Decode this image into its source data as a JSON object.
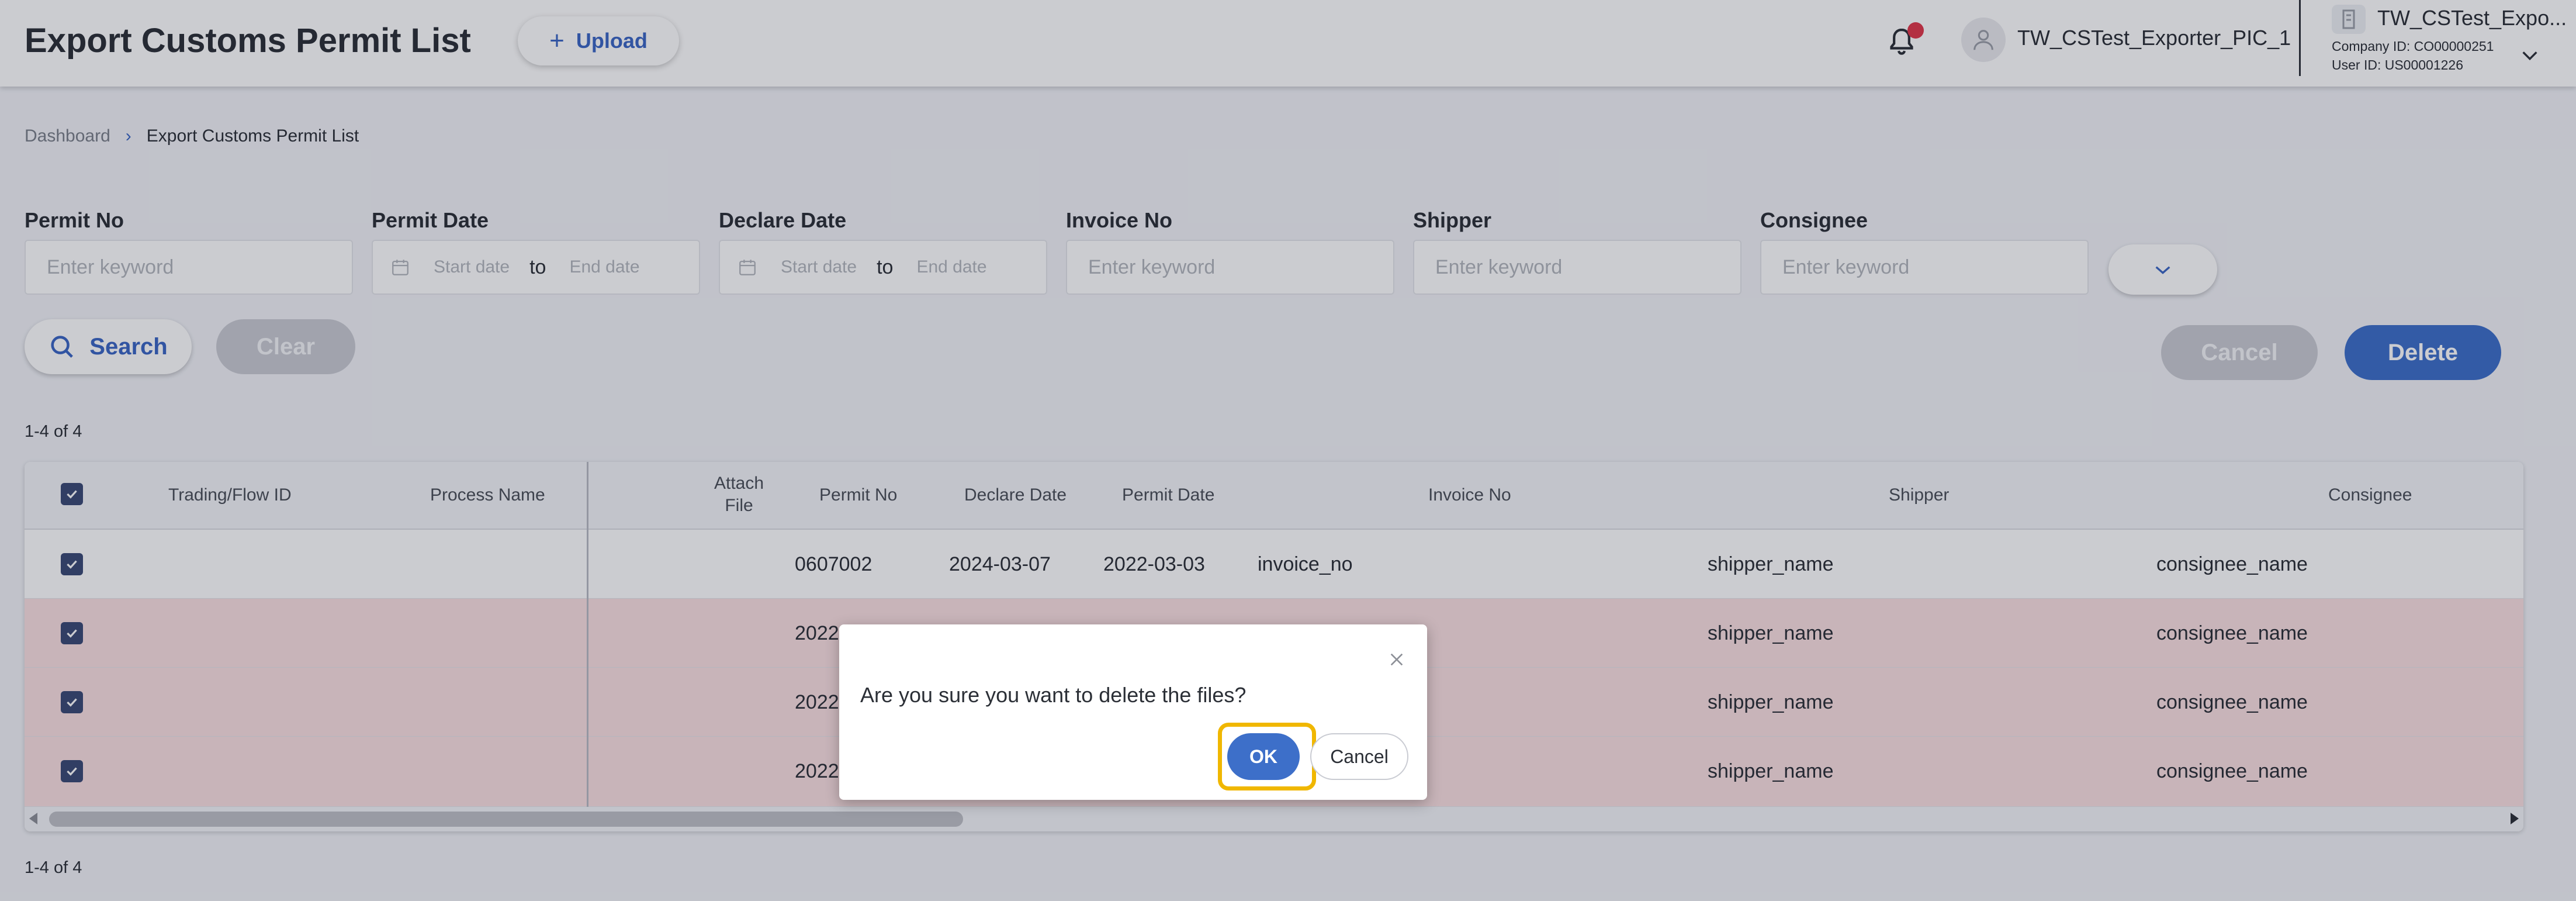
{
  "header": {
    "title": "Export Customs Permit List",
    "upload_label": "Upload",
    "user_name": "TW_CSTest_Exporter_PIC_1",
    "company_name": "TW_CSTest_Expo...",
    "company_id": "Company ID: CO00000251",
    "user_id": "User ID: US00001226"
  },
  "breadcrumb": {
    "home": "Dashboard",
    "separator": "›",
    "current": "Export Customs Permit List"
  },
  "filters": {
    "permit_no": {
      "label": "Permit No",
      "placeholder": "Enter keyword"
    },
    "permit_date": {
      "label": "Permit Date",
      "start": "Start date",
      "to": "to",
      "end": "End date"
    },
    "declare_date": {
      "label": "Declare Date",
      "start": "Start date",
      "to": "to",
      "end": "End date"
    },
    "invoice_no": {
      "label": "Invoice No",
      "placeholder": "Enter keyword"
    },
    "shipper": {
      "label": "Shipper",
      "placeholder": "Enter keyword"
    },
    "consignee": {
      "label": "Consignee",
      "placeholder": "Enter keyword"
    }
  },
  "actions": {
    "search": "Search",
    "clear": "Clear",
    "cancel": "Cancel",
    "delete": "Delete"
  },
  "pagination": {
    "count_top": "1-4 of 4",
    "count_bottom": "1-4 of 4"
  },
  "table": {
    "columns": {
      "trading_flow_id": "Trading/Flow ID",
      "process_name": "Process Name",
      "attach_file_1": "Attach",
      "attach_file_2": "File",
      "permit_no": "Permit No",
      "declare_date": "Declare Date",
      "permit_date": "Permit Date",
      "invoice_no": "Invoice No",
      "shipper": "Shipper",
      "consignee": "Consignee"
    },
    "rows": [
      {
        "permit_no": "0607002",
        "declare_date": "2024-03-07",
        "permit_date": "2022-03-03",
        "invoice_no": "invoice_no",
        "shipper": "shipper_name",
        "consignee": "consignee_name"
      },
      {
        "permit_no": "2022",
        "shipper": "shipper_name",
        "consignee": "consignee_name"
      },
      {
        "permit_no": "2022",
        "shipper": "shipper_name",
        "consignee": "consignee_name"
      },
      {
        "permit_no": "2022",
        "shipper": "shipper_name",
        "consignee": "consignee_name"
      }
    ]
  },
  "dialog": {
    "message": "Are you sure you want to delete the files?",
    "ok": "OK",
    "cancel": "Cancel"
  },
  "colors": {
    "accent": "#3d6fc9",
    "highlight": "#f0b700",
    "selected_row": "#fbe0e2",
    "notification": "#e0374a"
  },
  "icons": [
    "plus-icon",
    "bell-icon",
    "user-icon",
    "building-icon",
    "chevron-down-icon",
    "calendar-icon",
    "search-icon",
    "check-icon",
    "close-icon"
  ]
}
